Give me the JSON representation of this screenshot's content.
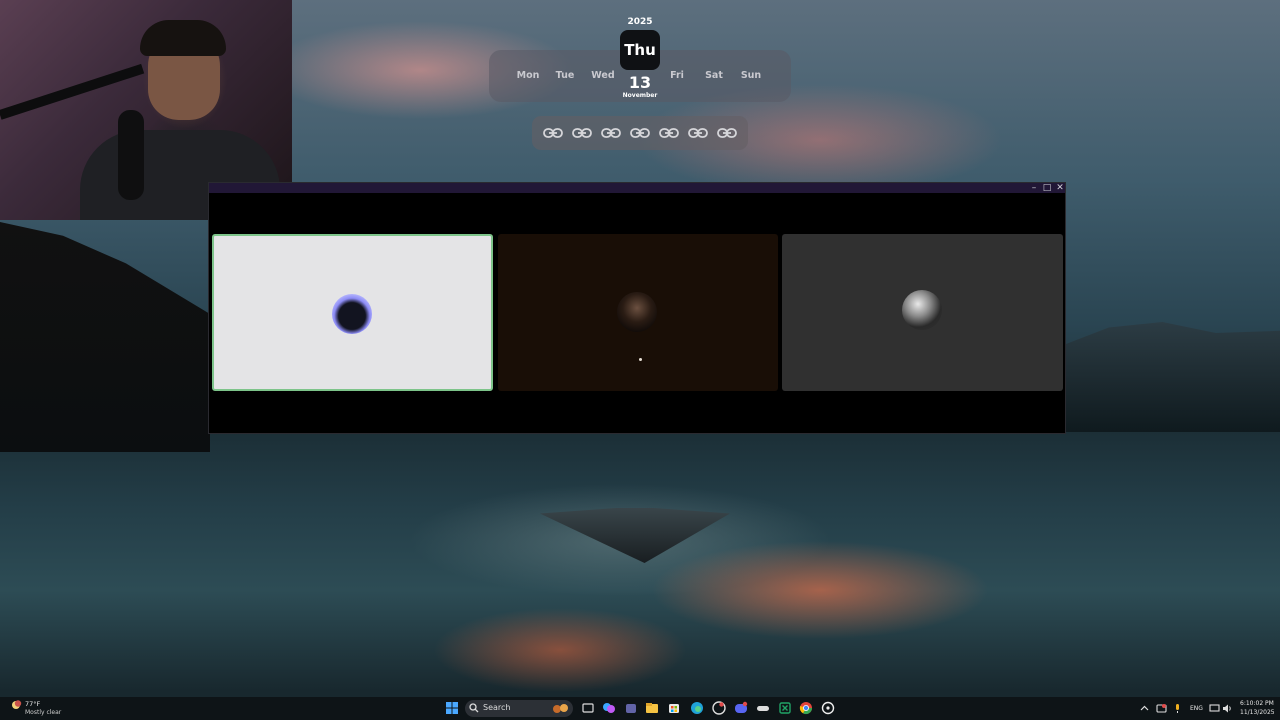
{
  "calendar": {
    "year": "2025",
    "days": [
      "Mon",
      "Tue",
      "Wed",
      "Thu",
      "Fri",
      "Sat",
      "Sun"
    ],
    "selected_day": "Thu",
    "date": "13",
    "month": "November"
  },
  "links_bar": {
    "icons": [
      "link-icon",
      "link-icon",
      "link-icon",
      "link-icon",
      "link-icon",
      "link-icon",
      "link-icon"
    ]
  },
  "window": {
    "controls": {
      "minimize": "–",
      "maximize": "□",
      "close": "✕"
    },
    "cards": [
      {
        "icon": "batman-avatar",
        "selected": true
      },
      {
        "icon": "person-avatar",
        "selected": false
      },
      {
        "icon": "orb-avatar",
        "selected": false
      }
    ]
  },
  "taskbar": {
    "weather": {
      "temp": "77°F",
      "condition": "Mostly clear"
    },
    "search_label": "Search",
    "apps": [
      "windows-start-icon",
      "task-view-icon",
      "copilot-icon",
      "teams-icon",
      "file-explorer-icon",
      "store-icon",
      "edge-icon",
      "github-icon",
      "discord-icon",
      "gamepad-icon",
      "excel-icon",
      "chrome-icon",
      "obs-icon"
    ],
    "tray": {
      "language": "ENG",
      "time": "6:10:02 PM",
      "date": "11/13/2025"
    }
  },
  "colors": {
    "accent_green": "#7dc48a",
    "titlebar_purple": "#211736",
    "taskbar_bg": "#0e1216"
  }
}
